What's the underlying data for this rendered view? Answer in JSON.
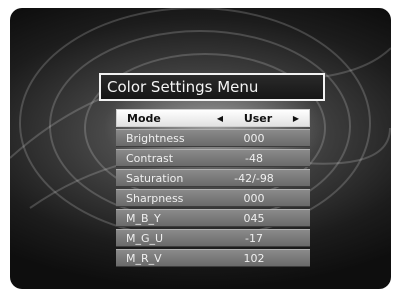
{
  "menu": {
    "title": "Color Settings Menu",
    "mode": {
      "label": "Mode",
      "value": "User",
      "left_arrow": "◀",
      "right_arrow": "▶"
    },
    "items": [
      {
        "label": "Brightness",
        "value": "000"
      },
      {
        "label": "Contrast",
        "value": "-48"
      },
      {
        "label": "Saturation",
        "value": "-42/-98"
      },
      {
        "label": "Sharpness",
        "value": "000"
      },
      {
        "label": "M_B_Y",
        "value": "045"
      },
      {
        "label": "M_G_U",
        "value": "-17"
      },
      {
        "label": "M_R_V",
        "value": "102"
      }
    ]
  }
}
